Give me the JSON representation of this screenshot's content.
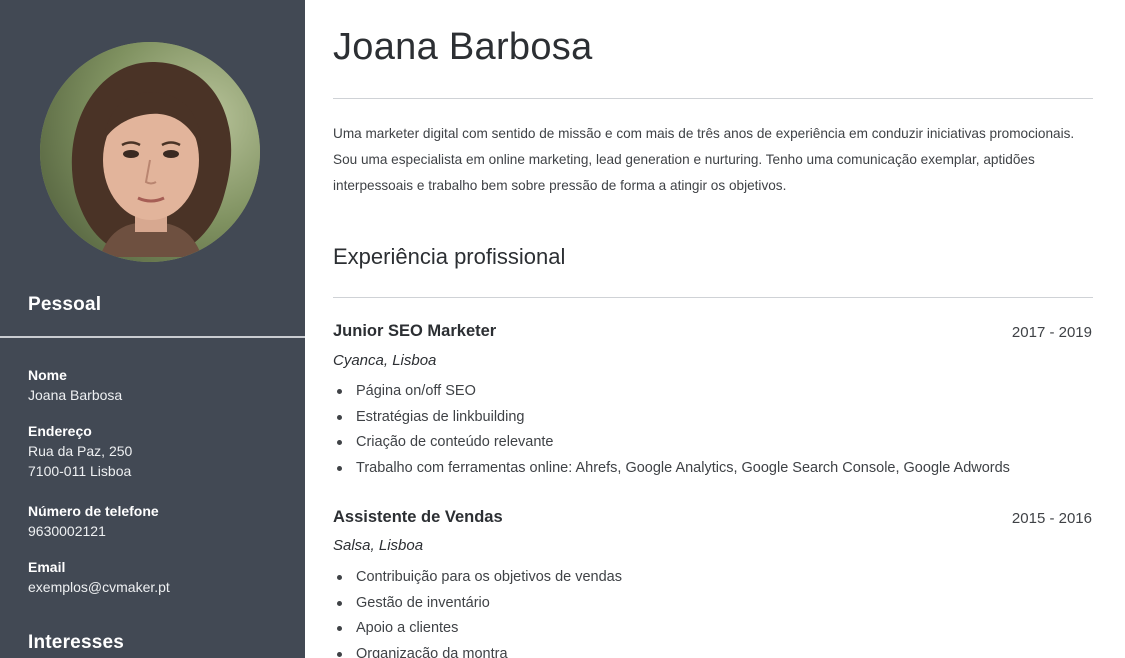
{
  "sidebar": {
    "personal_heading": "Pessoal",
    "fields": [
      {
        "label": "Nome",
        "values": [
          "Joana Barbosa"
        ]
      },
      {
        "label": "Endereço",
        "values": [
          "Rua da Paz, 250",
          "7100-011 Lisboa"
        ]
      },
      {
        "label": "Número de telefone",
        "values": [
          "9630002121"
        ]
      },
      {
        "label": "Email",
        "values": [
          "exemplos@cvmaker.pt"
        ]
      }
    ],
    "interests_heading": "Interesses"
  },
  "main": {
    "name": "Joana Barbosa",
    "summary": "Uma marketer digital com sentido de missão e com mais de três anos de experiência em conduzir iniciativas promocionais. Sou uma especialista em online marketing, lead generation e nurturing. Tenho uma comunicação exemplar, aptidões interpessoais e trabalho bem sobre pressão de forma a atingir os objetivos.",
    "experience_heading": "Experiência profissional",
    "jobs": [
      {
        "title": "Junior SEO Marketer",
        "dates": "2017 - 2019",
        "company": "Cyanca, Lisboa",
        "bullets": [
          "Página on/off SEO",
          "Estratégias de linkbuilding",
          "Criação de conteúdo relevante",
          "Trabalho com ferramentas online: Ahrefs, Google Analytics, Google Search Console, Google Adwords"
        ]
      },
      {
        "title": "Assistente de Vendas",
        "dates": "2015 - 2016",
        "company": "Salsa, Lisboa",
        "bullets": [
          "Contribuição para os objetivos de vendas",
          "Gestão de inventário",
          "Apoio a clientes",
          "Organização da montra"
        ]
      }
    ]
  }
}
